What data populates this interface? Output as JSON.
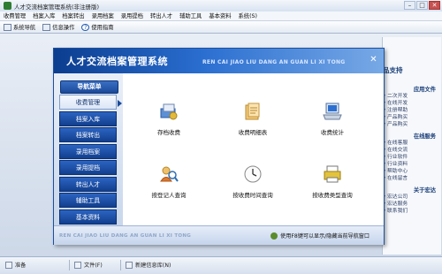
{
  "window": {
    "title": "人才交流档案管理系统(非注册版)"
  },
  "menubar": [
    "收費管理",
    "档案入库",
    "档案转出",
    "录用档案",
    "录用提档",
    "转出人才",
    "辅助工具",
    "基本资料",
    "系统(S)"
  ],
  "toolbar": [
    {
      "label": "系统导航",
      "icon": "nav-icon"
    },
    {
      "label": "信息操作",
      "icon": "info-icon"
    },
    {
      "label": "使用指南",
      "icon": "help-icon"
    }
  ],
  "dialog": {
    "title": "人才交流档案管理系统",
    "subtitle_pinyin": "REN CAI JIAO LIU DANG AN GUAN LI XI TONG",
    "close_symbol": "✕",
    "nav_header": "导航菜单",
    "nav_items": [
      "收费管理",
      "档案入库",
      "档案转出",
      "录用档案",
      "录用提档",
      "转出人才",
      "辅助工具",
      "基本资料"
    ],
    "active_nav": "收费管理",
    "functions": [
      {
        "label": "存档收费",
        "icon": "archive-fee-icon"
      },
      {
        "label": "收费明细表",
        "icon": "fee-detail-icon"
      },
      {
        "label": "收费统计",
        "icon": "fee-stats-icon"
      },
      {
        "label": "按登记人查询",
        "icon": "registrar-query-icon"
      },
      {
        "label": "按收费时间查询",
        "icon": "clock-query-icon"
      },
      {
        "label": "按收费类型查询",
        "icon": "type-query-icon"
      }
    ],
    "footer_pinyin": "REN CAI JIAO LIU DANG AN GUAN LI XI TONG",
    "footer_hint": "使用F8键可以显示/隐藏当前导航窗口"
  },
  "right_panel": {
    "top_label": "品支持",
    "sections": [
      {
        "title": "应用文件",
        "items": [
          "二次开发",
          "在线开发",
          "注册帮助",
          "产品购买",
          "产品购买"
        ]
      },
      {
        "title": "在线服务",
        "items": [
          "在线客服",
          "在线交流",
          "行业软件",
          "行业资料",
          "帮助中心",
          "在线留言"
        ]
      },
      {
        "title": "关于宏达",
        "items": [
          "宏达公司",
          "宏达服务",
          "联系我们"
        ]
      }
    ]
  },
  "statusbar": {
    "ready": "准备",
    "file": "文件(F)",
    "new": "新建信息库(N)"
  }
}
